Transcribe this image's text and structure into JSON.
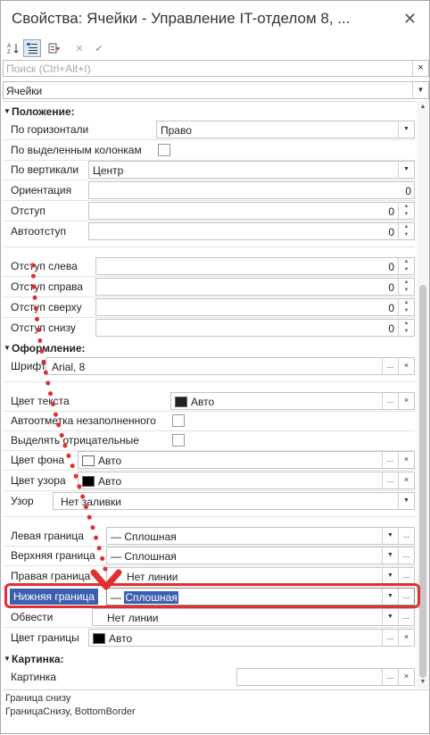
{
  "window": {
    "title": "Свойства: Ячейки - Управление IT-отделом 8, ...",
    "close_glyph": "✕"
  },
  "toolbar": {
    "sort_alpha_icon": "sort-alpha-icon",
    "categories_icon": "categories-icon",
    "filter_icon": "filter-icon",
    "cancel_glyph": "✕",
    "accept_glyph": "✔"
  },
  "search": {
    "placeholder": "Поиск (Ctrl+Alt+I)",
    "clear_glyph": "×"
  },
  "object_selector": {
    "value": "Ячейки",
    "dropdown_glyph": "▼"
  },
  "groups": {
    "position": "Положение:",
    "design": "Оформление:",
    "picture": "Картинка:"
  },
  "props": {
    "horizontal": {
      "label": "По горизонтали",
      "value": "Право"
    },
    "by_selected_columns": {
      "label": "По выделенным колонкам",
      "checked": false
    },
    "vertical": {
      "label": "По вертикали",
      "value": "Центр"
    },
    "orientation": {
      "label": "Ориентация",
      "value": "0"
    },
    "indent": {
      "label": "Отступ",
      "value": "0"
    },
    "auto_indent": {
      "label": "Автоотступ",
      "value": "0"
    },
    "indent_left": {
      "label": "Отступ слева",
      "value": "0"
    },
    "indent_right": {
      "label": "Отступ справа",
      "value": "0"
    },
    "indent_top": {
      "label": "Отступ сверху",
      "value": "0"
    },
    "indent_bottom": {
      "label": "Отступ снизу",
      "value": "0"
    },
    "font": {
      "label": "Шрифт",
      "value": "Arial, 8"
    },
    "text_color": {
      "label": "Цвет текста",
      "value": "Авто",
      "swatch": "#222222"
    },
    "auto_mark_empty": {
      "label": "Автоотметка незаполненного",
      "checked": false
    },
    "highlight_negative": {
      "label": "Выделять отрицательные",
      "checked": false
    },
    "bg_color": {
      "label": "Цвет фона",
      "value": "Авто",
      "swatch": "#ffffff"
    },
    "pattern_color": {
      "label": "Цвет узора",
      "value": "Авто",
      "swatch": "#000000"
    },
    "pattern": {
      "label": "Узор",
      "value": "Нет заливки"
    },
    "left_border": {
      "label": "Левая граница",
      "value": "— Сплошная"
    },
    "top_border": {
      "label": "Верхняя граница",
      "value": "— Сплошная"
    },
    "right_border": {
      "label": "Правая граница",
      "value": "Нет линии"
    },
    "bottom_border": {
      "label": "Нижняя граница",
      "prefix": "—",
      "value": "Сплошная"
    },
    "outline": {
      "label": "Обвести",
      "value": "Нет линии"
    },
    "border_color": {
      "label": "Цвет границы",
      "value": "Авто",
      "swatch": "#000000"
    },
    "picture": {
      "label": "Картинка",
      "value": ""
    }
  },
  "buttons": {
    "dots": "...",
    "x": "×",
    "dd": "▼"
  },
  "spin": {
    "up": "▲",
    "down": "▼"
  },
  "description": {
    "line1": "Граница снизу",
    "line2": "ГраницаСнизу, BottomBorder"
  },
  "colors": {
    "selection": "#3c5fb0",
    "annotation": "#e03030"
  }
}
